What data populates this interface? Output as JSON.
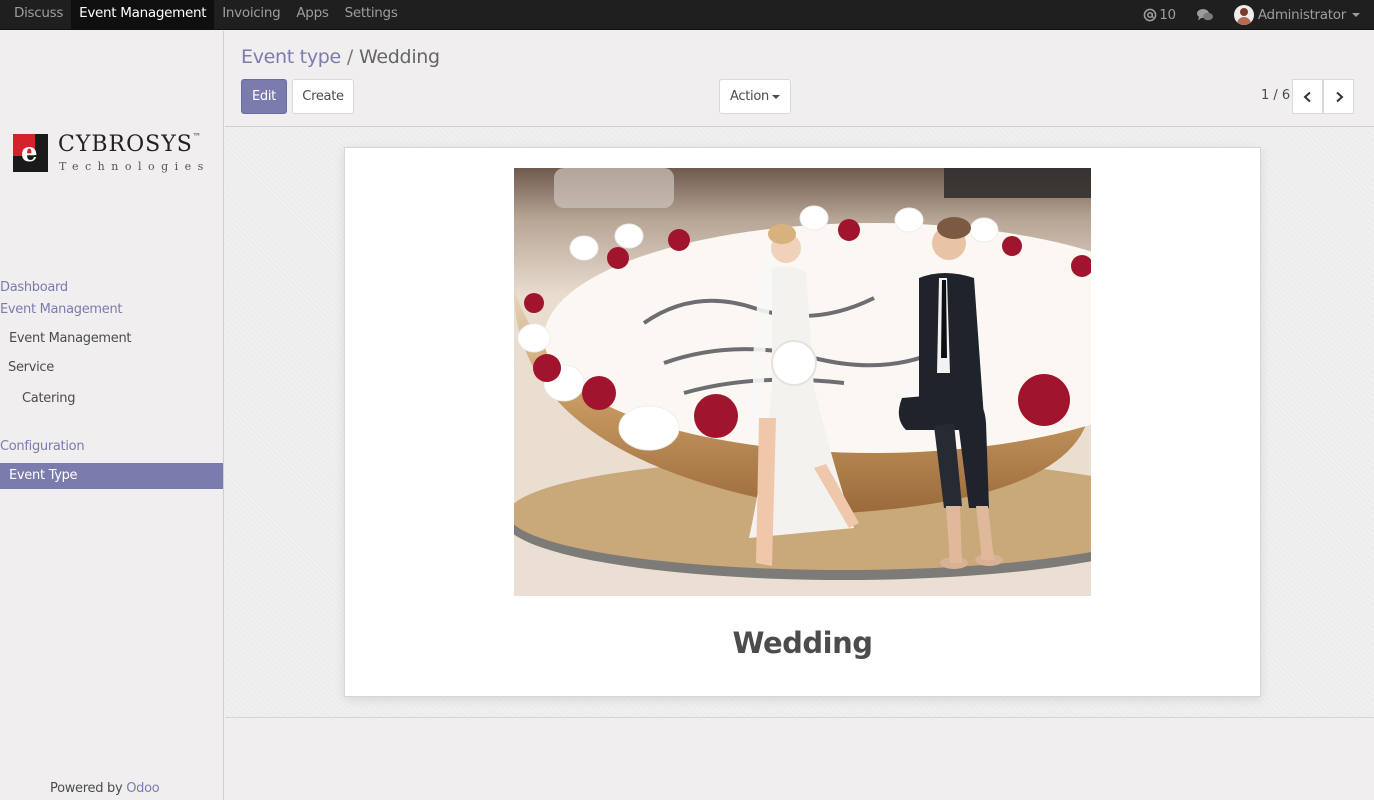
{
  "topnav": {
    "menus": [
      {
        "label": "Discuss",
        "active": false
      },
      {
        "label": "Event Management",
        "active": true
      },
      {
        "label": "Invoicing",
        "active": false
      },
      {
        "label": "Apps",
        "active": false
      },
      {
        "label": "Settings",
        "active": false
      }
    ],
    "notifications_count": "10",
    "notification_icon": "at-icon",
    "chat_icon": "chat-bubbles-icon",
    "user_name": "Administrator"
  },
  "sidebar": {
    "logo": {
      "brand": "CYBROSYS",
      "trademark": "™",
      "tagline": "Technologies"
    },
    "sections": {
      "dashboard": "Dashboard",
      "event_management": "Event Management",
      "event_management_item": "Event Management",
      "service": "Service",
      "catering": "Catering",
      "configuration": "Configuration",
      "event_type": "Event Type"
    },
    "powered_by": "Powered by",
    "powered_by_link": "Odoo"
  },
  "control_panel": {
    "breadcrumb_parent": "Event type",
    "breadcrumb_separator": "/",
    "breadcrumb_current": "Wedding",
    "edit_label": "Edit",
    "create_label": "Create",
    "action_label": "Action",
    "pager": "1 / 6",
    "prev_icon": "chevron-left-icon",
    "next_icon": "chevron-right-icon"
  },
  "record": {
    "image_subject": "wedding-cake-with-bride-and-groom-figurines",
    "name": "Wedding"
  },
  "colors": {
    "brand": "#7c7bad",
    "navbar": "#1f1f1f",
    "background": "#f0eeee"
  }
}
